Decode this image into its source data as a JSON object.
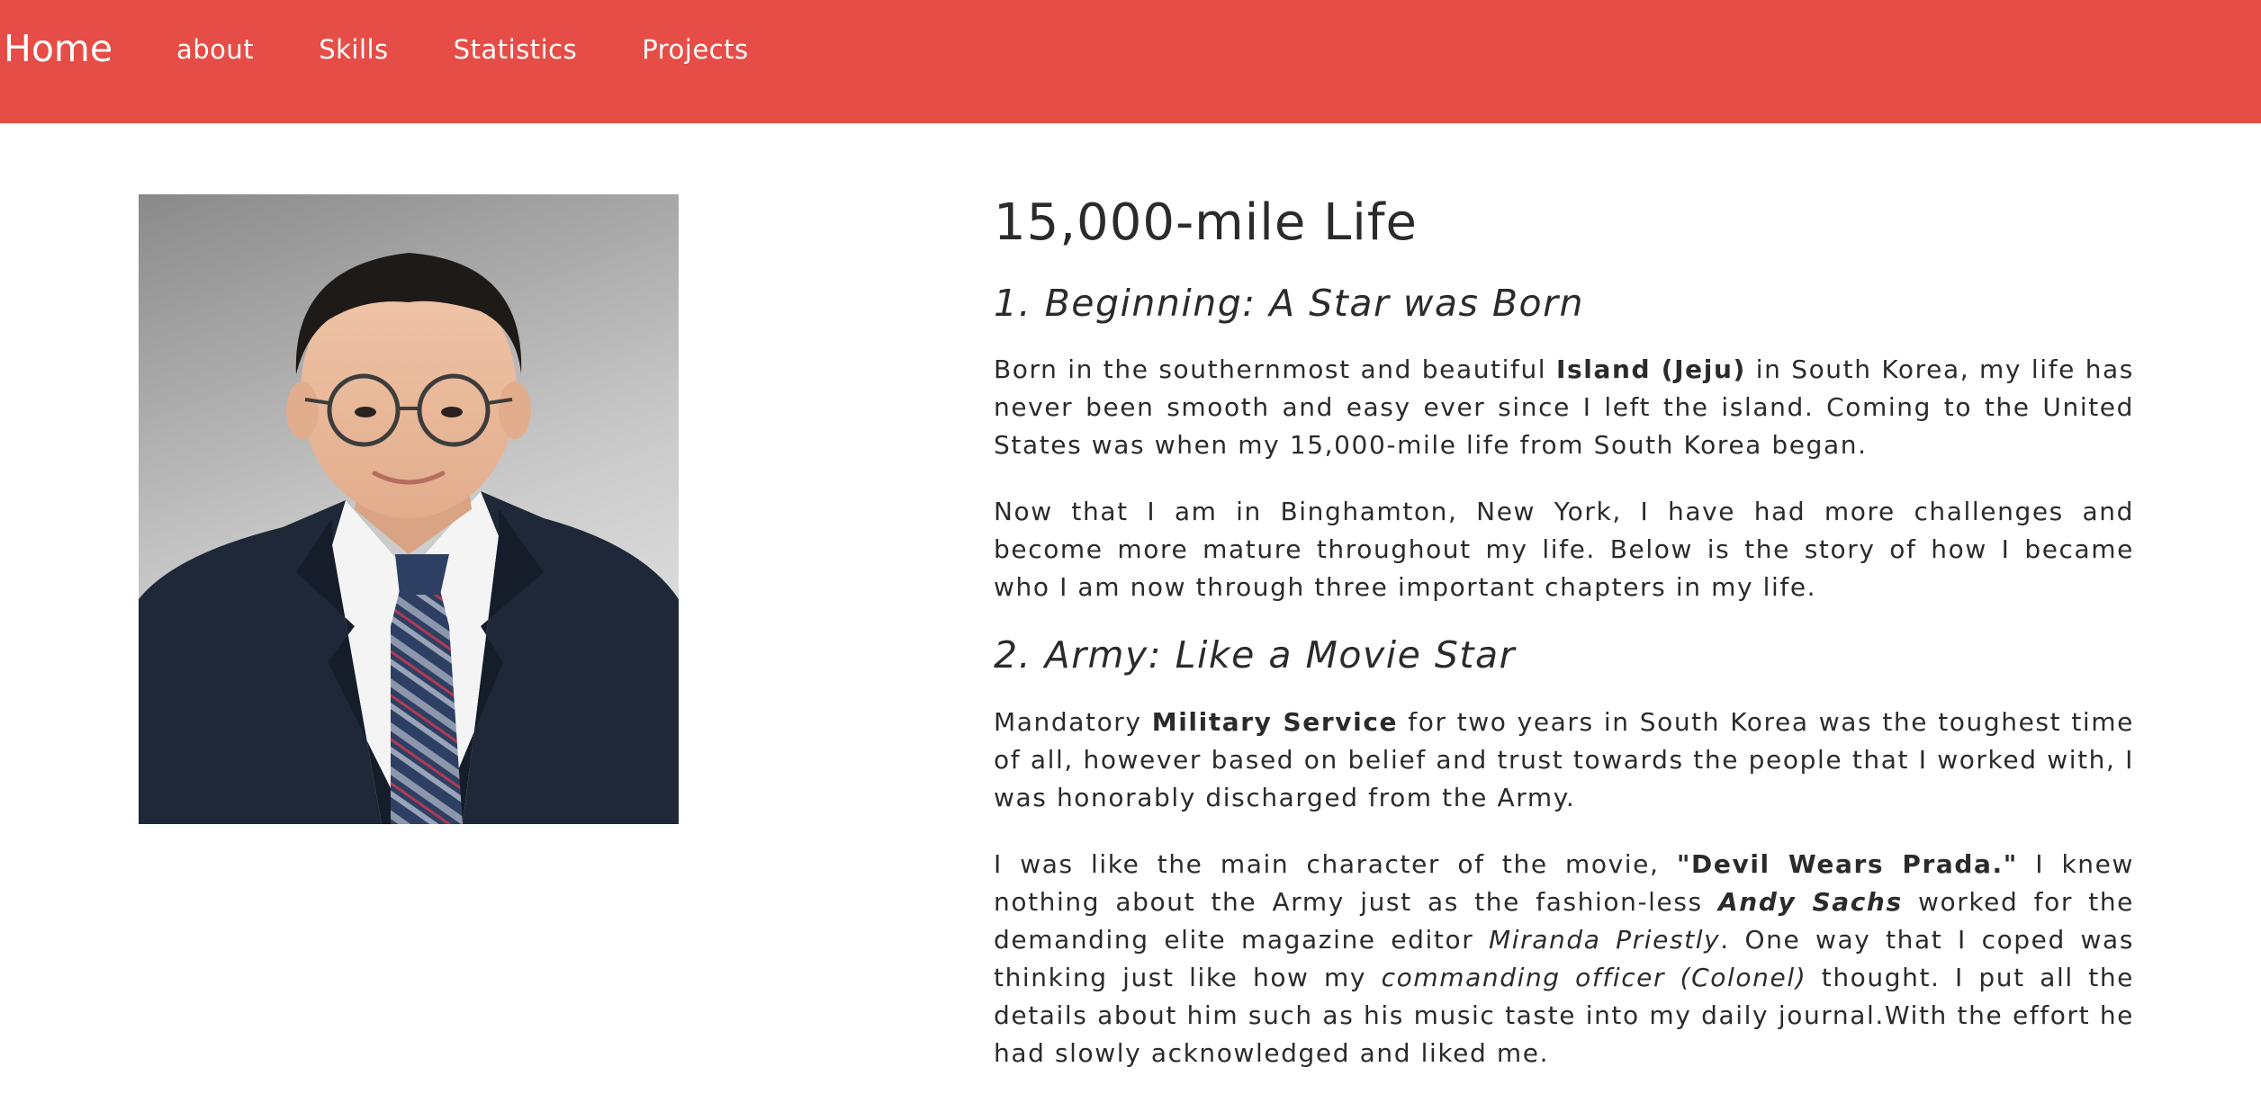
{
  "nav": {
    "brand": "Home",
    "links": [
      "about",
      "Skills",
      "Statistics",
      "Projects"
    ]
  },
  "colors": {
    "navbar_bg": "#e54d46",
    "nav_text": "#ffffff",
    "body_text": "#2b2b2b"
  },
  "content": {
    "title": "15,000-mile Life",
    "section1": {
      "heading": "1. Beginning: A Star was Born",
      "p1": {
        "a": "Born in the southernmost and beautiful ",
        "bold": "Island (Jeju)",
        "b": " in South Korea, my life has never been smooth and easy ever since I left the island. Coming to the United States was when my 15,000-mile life from South Korea began."
      },
      "p2": "Now that I am in Binghamton, New York, I have had more challenges and become more mature throughout my life. Below is the story of how I became who I am now through three important chapters in my life."
    },
    "section2": {
      "heading": "2. Army: Like a Movie Star",
      "p1": {
        "a": "Mandatory ",
        "bold": "Military Service",
        "b": " for two years in South Korea was the toughest time of all, however based on belief and trust towards the people that I worked with, I was honorably discharged from the Army."
      },
      "p2": {
        "a": "I was like the main character of the movie, ",
        "bold1": "\"Devil Wears Prada.\"",
        "b": " I knew nothing about the Army just as the fashion-less ",
        "bolditalic": "Andy Sachs",
        "c": " worked for the demanding elite magazine editor ",
        "italic1": "Miranda Priestly",
        "d": ". One way that I coped was thinking just like how my ",
        "italic2": "commanding officer (Colonel)",
        "e": " thought. I put all the details about him such as his music taste into my daily journal.With the effort he had slowly acknowledged and liked me."
      }
    }
  }
}
